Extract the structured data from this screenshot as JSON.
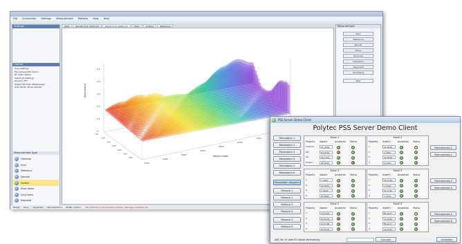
{
  "app1": {
    "menu": [
      "File",
      "Connection",
      "Settings",
      "Measurement",
      "Markers",
      "View",
      "Help"
    ],
    "left": {
      "selection_header": "Settings",
      "outline_header": "Outline",
      "outline_lines": [
        "Scan Settings",
        "File name prefix: Demo",
        "RF Vidth: 10mm",
        "Spectrum Settings",
        "Domain: FFT",
        "Output Window: MaxAverage",
        "Scan Mode: 3D ell Vibrate"
      ],
      "measurement_type_header": "Measurement type",
      "measurement_types": [
        "Overview",
        "Scan",
        "Reference",
        "Spectral",
        "Surface",
        "Short frame",
        "Long frame",
        "Regnated"
      ],
      "selected_index": 4
    },
    "tabs": [
      "Start",
      "Results Scan 2009.svd",
      "Result Scan 2009.svd",
      "Video",
      "Surface",
      "Reference"
    ],
    "right": {
      "header": "Measurement",
      "buttons": [
        "Start",
        "Reference",
        "Results",
        "Setup",
        "Overview",
        "Acquisition",
        "Alignment",
        "Processing",
        "Stop"
      ]
    },
    "statusbar": [
      "Ready",
      "Busy",
      "Hyperfast",
      "Get selections",
      "Buffer contour"
    ],
    "error_text": "The software is permanently started; debugger available (6)."
  },
  "plot": {
    "y_ticks": [
      "0.5",
      "0.4",
      "0.3",
      "0.2",
      "0.1",
      "0"
    ],
    "x_ticks": [
      "1000",
      "2000",
      "3000",
      "4000",
      "5000",
      "6000",
      "7000",
      "8000"
    ],
    "depth_ticks": [
      "50",
      "100",
      "150",
      "200",
      "250",
      "300",
      "350"
    ],
    "x_label": "Wavenumber",
    "y_label": "Absorbance"
  },
  "app2": {
    "window_title": "PSS Server Demo Client",
    "heading": "Polytec PSS Server Demo Client",
    "messdaten_buttons": [
      "Messdaten 1",
      "Messdaten 2",
      "Messdaten 3",
      "Messdaten 4",
      "Messdaten 5",
      "Messdaten 6",
      "Messdaten Abgreen"
    ],
    "relais_buttons": [
      "Relasco 1",
      "Relasco 2",
      "Relasco 3",
      "Relasco 4",
      "Relasco 5",
      "Relasco 6"
    ],
    "potential_buttons": [
      "Potenzialmes 1",
      "Potenzialmes 2",
      "Potenzialmes 3",
      "Potenzialmes 4",
      "Potenzialmes 5",
      "Potenzialmes 6"
    ],
    "columns": [
      "Property",
      "Istwert",
      "Auswerter",
      "Status"
    ],
    "kanals": [
      {
        "title": "Kanal 1",
        "rows": [
          {
            "p": "Acetone",
            "v": "91.2350",
            "a": "green",
            "s": "green"
          },
          {
            "p": "Fat",
            "v": "84.2453",
            "a": "red",
            "s": "green"
          },
          {
            "p": "Oil",
            "v": "90.2359",
            "a": "green",
            "s": "green"
          },
          {
            "p": "Protein",
            "v": "96.2453",
            "a": "green",
            "s": "red"
          }
        ]
      },
      {
        "title": "Kanal 2",
        "rows": [
          {
            "p": "1",
            "v": "90.8534",
            "a": "green",
            "s": "yellow"
          },
          {
            "p": "2",
            "v": "2.3050",
            "a": "green",
            "s": "green"
          },
          {
            "p": "3",
            "v": "90.8534",
            "a": "green",
            "s": "green"
          },
          {
            "p": "4",
            "v": "2.3050",
            "a": "green",
            "s": "green"
          }
        ]
      },
      {
        "title": "Kanal 3",
        "rows": [
          {
            "p": "1",
            "v": "1.4524",
            "a": "green",
            "s": "green"
          },
          {
            "p": "2",
            "v": "90.8647",
            "a": "red",
            "s": "green"
          },
          {
            "p": "3",
            "v": "1.4524",
            "a": "green",
            "s": "green"
          },
          {
            "p": "4",
            "v": "90.8647",
            "a": "red",
            "s": "green"
          }
        ]
      },
      {
        "title": "Kanal 4",
        "rows": [
          {
            "p": "1",
            "v": "95.2746",
            "a": "green",
            "s": "green"
          },
          {
            "p": "2",
            "v": "1.1642",
            "a": "green",
            "s": "green"
          },
          {
            "p": "3",
            "v": "95.2746",
            "a": "green",
            "s": "green"
          },
          {
            "p": "4",
            "v": "1.1642",
            "a": "green",
            "s": "green"
          }
        ]
      },
      {
        "title": "Kanal 5",
        "rows": [
          {
            "p": "1",
            "v": "54.1158",
            "a": "green",
            "s": "green"
          },
          {
            "p": "2",
            "v": "83.5225",
            "a": "red",
            "s": "green"
          },
          {
            "p": "3",
            "v": "54.1158",
            "a": "green",
            "s": "green"
          },
          {
            "p": "4",
            "v": "83.5225",
            "a": "red",
            "s": "green"
          }
        ]
      },
      {
        "title": "Kanal 6",
        "rows": [
          {
            "p": "1",
            "v": "85.2277",
            "a": "green",
            "s": "yellow"
          },
          {
            "p": "2",
            "v": "14.2925",
            "a": "green",
            "s": "green"
          },
          {
            "p": "3",
            "v": "85.2277",
            "a": "green",
            "s": "green"
          },
          {
            "p": "4",
            "v": "14.2925",
            "a": "green",
            "s": "green"
          }
        ]
      }
    ],
    "ip_label": "ABC Ser IO (bee für lokale Verbindung)",
    "connect_label": "Connect",
    "close_label": "Schließen"
  }
}
